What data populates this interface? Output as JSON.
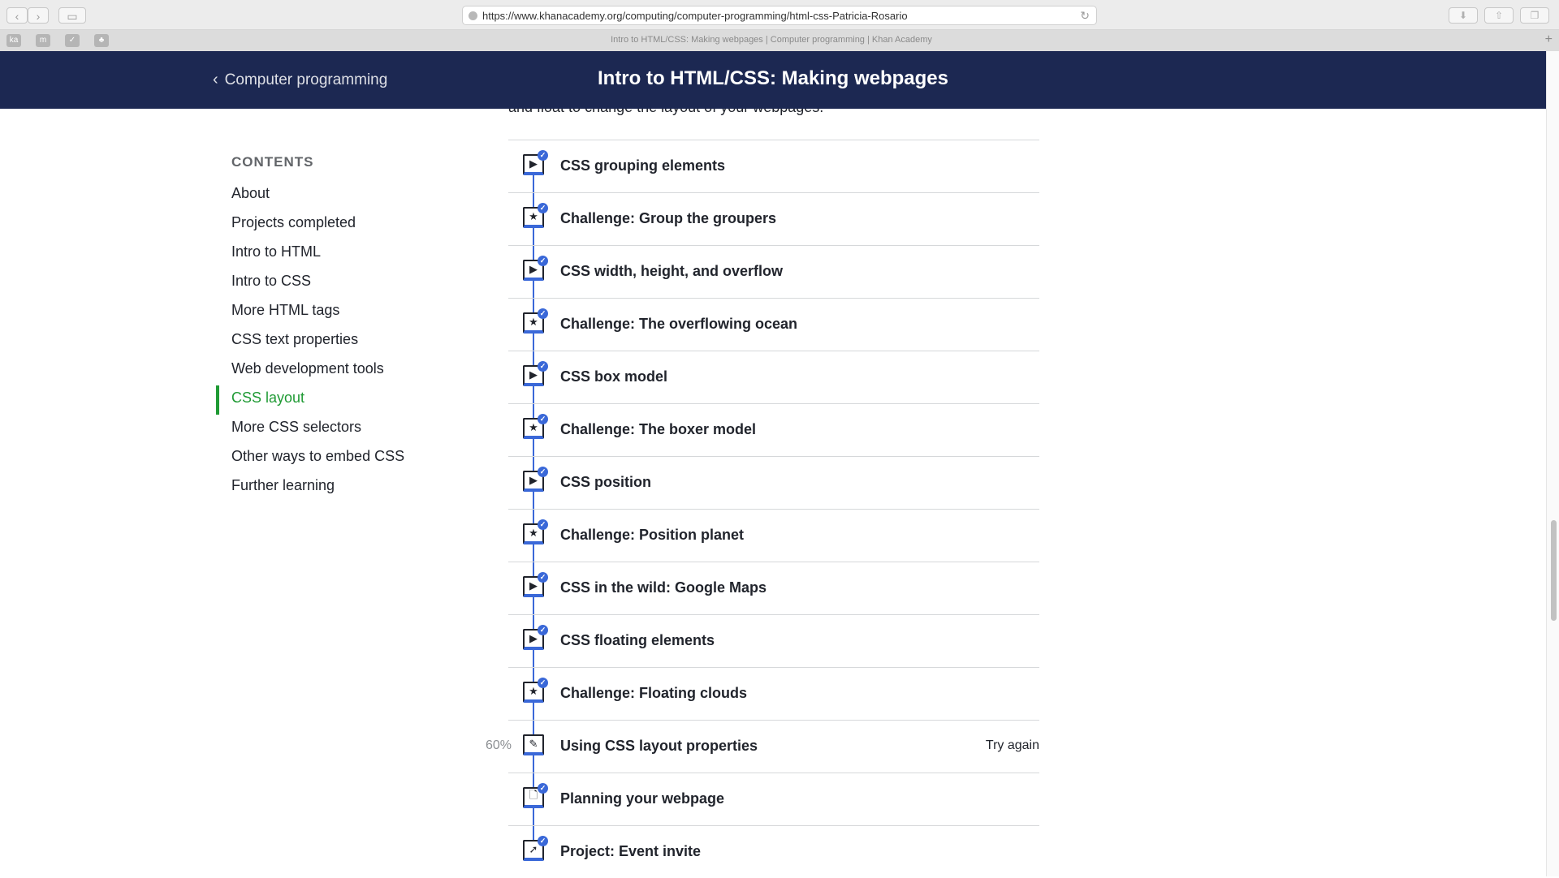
{
  "browser": {
    "url": "https://www.khanacademy.org/computing/computer-programming/html-css-Patricia-Rosario",
    "tab_title": "Intro to HTML/CSS: Making webpages | Computer programming | Khan Academy",
    "favicons": [
      "ka",
      "m",
      "✓",
      "♣"
    ]
  },
  "header": {
    "back_label": "Computer programming",
    "title": "Intro to HTML/CSS: Making webpages"
  },
  "intro_partial_text": "and float to change the layout of your webpages.",
  "sidebar": {
    "heading": "CONTENTS",
    "items": [
      {
        "label": "About"
      },
      {
        "label": "Projects completed"
      },
      {
        "label": "Intro to HTML"
      },
      {
        "label": "Intro to CSS"
      },
      {
        "label": "More HTML tags"
      },
      {
        "label": "CSS text properties"
      },
      {
        "label": "Web development tools"
      },
      {
        "label": "CSS layout",
        "active": true
      },
      {
        "label": "More CSS selectors"
      },
      {
        "label": "Other ways to embed CSS"
      },
      {
        "label": "Further learning"
      }
    ]
  },
  "lessons": [
    {
      "title": "CSS grouping elements",
      "icon": "play-icon",
      "completed": true
    },
    {
      "title": "Challenge: Group the groupers",
      "icon": "star-icon",
      "completed": true
    },
    {
      "title": "CSS width, height, and overflow",
      "icon": "play-icon",
      "completed": true
    },
    {
      "title": "Challenge: The overflowing ocean",
      "icon": "star-icon",
      "completed": true
    },
    {
      "title": "CSS box model",
      "icon": "play-icon",
      "completed": true
    },
    {
      "title": "Challenge: The boxer model",
      "icon": "star-icon",
      "completed": true
    },
    {
      "title": "CSS position",
      "icon": "play-icon",
      "completed": true
    },
    {
      "title": "Challenge: Position planet",
      "icon": "star-icon",
      "completed": true
    },
    {
      "title": "CSS in the wild: Google Maps",
      "icon": "play-icon",
      "completed": true
    },
    {
      "title": "CSS floating elements",
      "icon": "play-icon",
      "completed": true
    },
    {
      "title": "Challenge: Floating clouds",
      "icon": "star-icon",
      "completed": true
    },
    {
      "title": "Using CSS layout properties",
      "icon": "pencil-icon",
      "completed": false,
      "percent": "60%",
      "action": "Try again"
    },
    {
      "title": "Planning your webpage",
      "icon": "document-icon",
      "completed": true
    },
    {
      "title": "Project: Event invite",
      "icon": "rocket-icon",
      "completed": true
    }
  ],
  "colors": {
    "header_bg": "#1c2852",
    "active_green": "#1f9a34",
    "progress_blue": "#3a68d8"
  }
}
